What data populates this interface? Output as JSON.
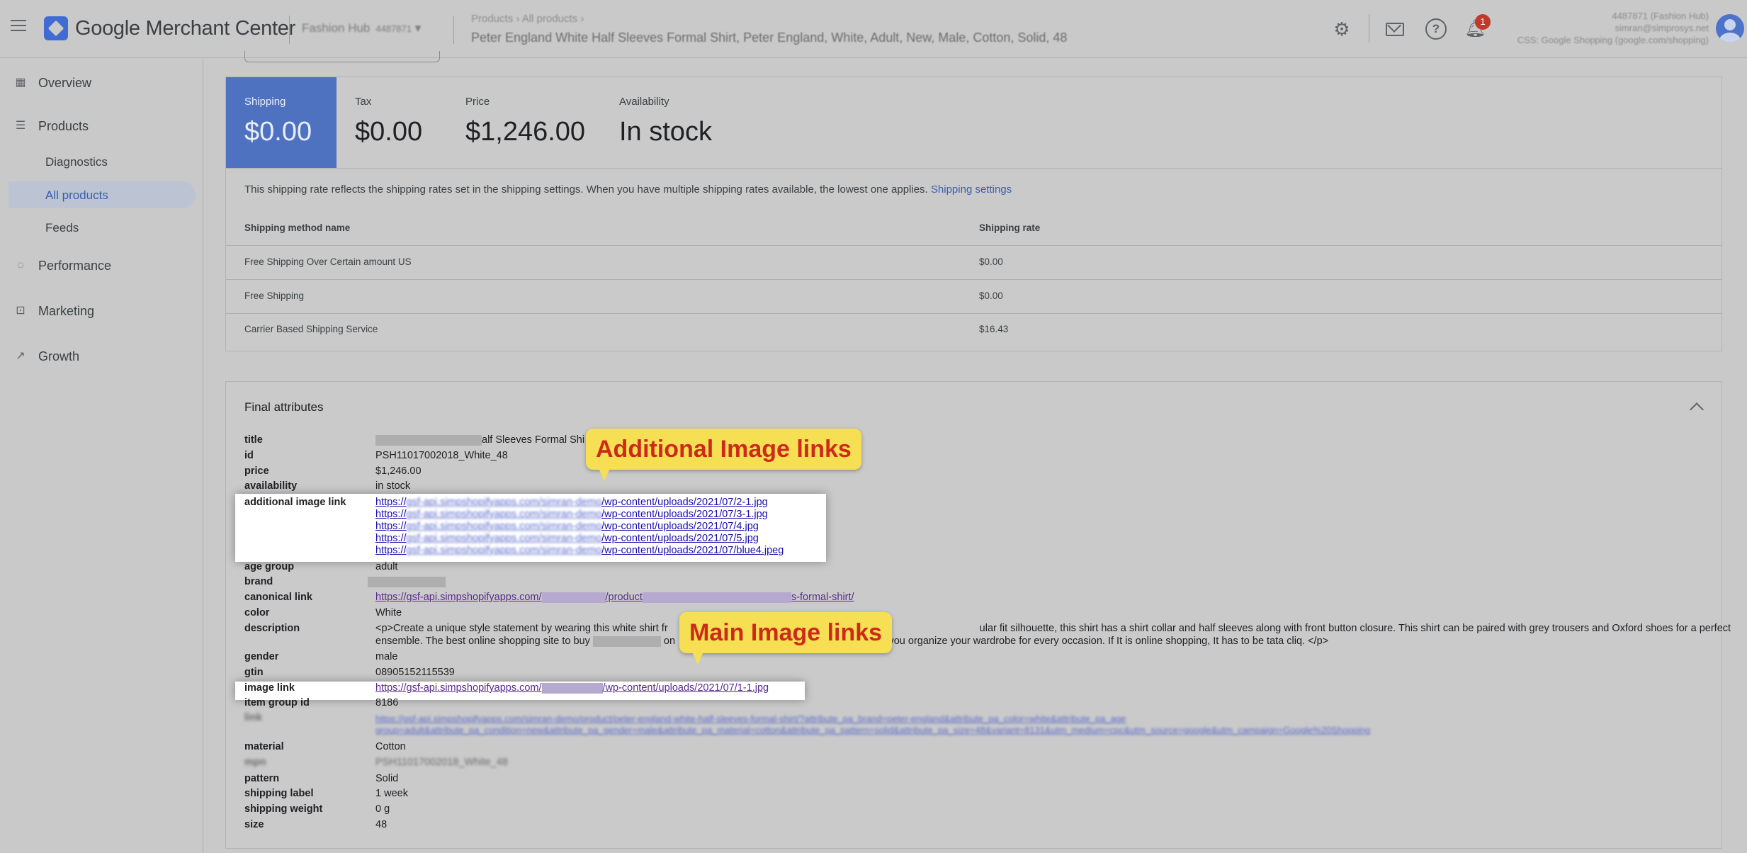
{
  "header": {
    "menu_icon": "menu-icon",
    "app_title": "Google Merchant Center",
    "account_name": "Fashion Hub",
    "account_id": "4487871",
    "breadcrumb": "Products  ›  All products  ›",
    "page_title": "Peter England White Half Sleeves Formal Shirt, Peter England, White, Adult, New, Male, Cotton, Solid, 48",
    "notification_count": "1",
    "account_lines": [
      "4487871 (Fashion Hub)",
      "simran@simprosys.net",
      "CSS: Google Shopping (google.com/shopping)"
    ]
  },
  "sidebar": {
    "items": [
      {
        "label": "Overview",
        "icon": "dashboard-icon"
      },
      {
        "label": "Products",
        "icon": "list-icon"
      },
      {
        "label": "Diagnostics"
      },
      {
        "label": "All products"
      },
      {
        "label": "Feeds"
      },
      {
        "label": "Performance",
        "icon": "performance-icon"
      },
      {
        "label": "Marketing",
        "icon": "bag-icon"
      },
      {
        "label": "Growth",
        "icon": "trend-icon"
      }
    ]
  },
  "summary": {
    "shipping_label": "Shipping",
    "shipping_value": "$0.00",
    "tax_label": "Tax",
    "tax_value": "$0.00",
    "price_label": "Price",
    "price_value": "$1,246.00",
    "availability_label": "Availability",
    "availability_value": "In stock"
  },
  "shipping": {
    "note": "This shipping rate reflects the shipping rates set in the shipping settings. When you have multiple shipping rates available, the lowest one applies.",
    "settings_link": "Shipping settings",
    "col_method": "Shipping method name",
    "col_rate": "Shipping rate",
    "rows": [
      {
        "name": "Free Shipping Over Certain amount US",
        "rate": "$0.00"
      },
      {
        "name": "Free Shipping",
        "rate": "$0.00"
      },
      {
        "name": "Carrier Based Shipping Service",
        "rate": "$16.43"
      }
    ]
  },
  "final_attributes": {
    "title": "Final attributes",
    "rows": {
      "title": {
        "key": "title",
        "value": "alf Sleeves Formal Shi"
      },
      "id": {
        "key": "id",
        "value": "PSH11017002018_White_48"
      },
      "price": {
        "key": "price",
        "value": "$1,246.00"
      },
      "availability": {
        "key": "availability",
        "value": "in stock"
      },
      "additional_image_link": {
        "key": "additional image link",
        "prefix": "https://",
        "values": [
          "/wp-content/uploads/2021/07/2-1.jpg",
          "/wp-content/uploads/2021/07/3-1.jpg",
          "/wp-content/uploads/2021/07/4.jpg",
          "/wp-content/uploads/2021/07/5.jpg",
          "/wp-content/uploads/2021/07/blue4.jpeg"
        ]
      },
      "age_group": {
        "key": "age group",
        "value": "adult"
      },
      "brand": {
        "key": "brand"
      },
      "canonical_link": {
        "key": "canonical link",
        "part1": "https://gsf-api.simpshopifyapps.com/",
        "part2": "/product",
        "part3": "s-formal-shirt/"
      },
      "color": {
        "key": "color",
        "value": "White"
      },
      "description": {
        "key": "description",
        "line1a": "<p>Create a unique style statement by wearing this white shirt fr",
        "line1b": "ular fit silhouette, this shirt has a shirt collar and half sleeves along with front button closure. This shirt can be paired with grey trousers and Oxford shoes for a perfect",
        "line2a": "ensemble. The best online shopping site to buy",
        "line2b": "on",
        "line2c": "help you organize your wardrobe for every occasion. If It is online shopping, It has to be tata cliq. </p>"
      },
      "gender": {
        "key": "gender",
        "value": "male"
      },
      "gtin": {
        "key": "gtin",
        "value": "08905152115539"
      },
      "image_link": {
        "key": "image link",
        "part1": "https://gsf-api.simpshopifyapps.com/",
        "part2": "/wp-content/uploads/2021/07/1-1.jpg"
      },
      "item_group_id": {
        "key": "item group id",
        "value": "8186"
      },
      "link": {
        "key": "link",
        "line1": "https://gsf-api.simpshopifyapps.com/simran-demo/product/peter-england-white-half-sleeves-formal-shirt/?attribute_pa_brand=peter-england&attribute_pa_color=white&attribute_pa_age",
        "line2": "group=adult&attribute_pa_condition=new&attribute_pa_gender=male&attribute_pa_material=cotton&attribute_pa_pattern=solid&attribute_pa_size=48&variant=8131&utm_medium=cpc&utm_source=google&utm_campaign=Google%20Shopping"
      },
      "material": {
        "key": "material",
        "value": "Cotton"
      },
      "mpn": {
        "key": "mpn",
        "value": "PSH11017002018_White_48"
      },
      "pattern": {
        "key": "pattern",
        "value": "Solid"
      },
      "shipping_label": {
        "key": "shipping label",
        "value": "1 week"
      },
      "shipping_weight": {
        "key": "shipping weight",
        "value": "0 g"
      },
      "size": {
        "key": "size",
        "value": "48"
      }
    }
  },
  "annotations": {
    "additional": "Additional Image links",
    "main": "Main Image links"
  },
  "colors": {
    "accent": "#4f72c0",
    "callout_bg": "#f6df53",
    "callout_text": "#cc2a1a",
    "badge": "#c0392b"
  }
}
